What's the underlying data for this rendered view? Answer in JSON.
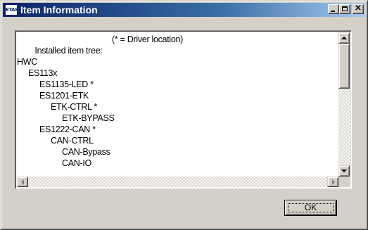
{
  "window": {
    "title": "Item Information",
    "app_icon_text": "ETAS",
    "close_glyph": "×"
  },
  "list": {
    "header_label": "Installed item tree:",
    "header_note": "(* = Driver location)",
    "tree": [
      {
        "text": "HWC",
        "level": 0
      },
      {
        "text": "ES113x",
        "level": 1
      },
      {
        "text": "ES1135-LED *",
        "level": 2
      },
      {
        "text": "ES1201-ETK",
        "level": 2
      },
      {
        "text": "ETK-CTRL *",
        "level": 3
      },
      {
        "text": "ETK-BYPASS",
        "level": 4
      },
      {
        "text": "ES1222-CAN *",
        "level": 2
      },
      {
        "text": "CAN-CTRL",
        "level": 3
      },
      {
        "text": "CAN-Bypass",
        "level": 4
      },
      {
        "text": "CAN-IO",
        "level": 4
      }
    ]
  },
  "buttons": {
    "ok_label": "OK"
  },
  "colors": {
    "titlebar_start": "#0a246a",
    "titlebar_end": "#a6caf0",
    "face": "#d4d0c8"
  }
}
